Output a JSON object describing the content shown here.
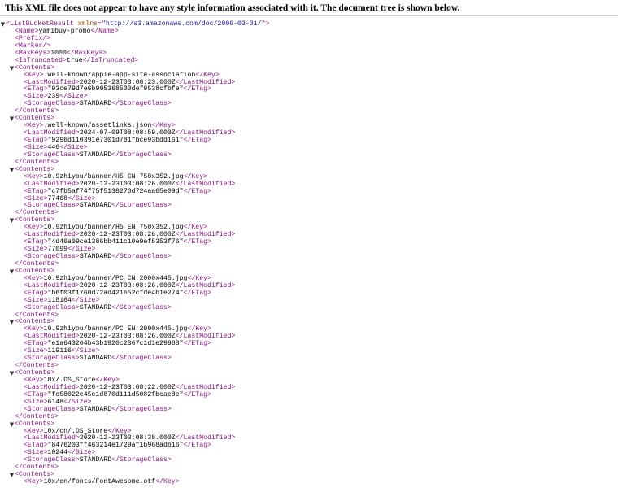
{
  "banner": "This XML file does not appear to have any style information associated with it. The document tree is shown below.",
  "root": {
    "tag": "ListBucketResult",
    "xmlns_attr": "xmlns",
    "xmlns": "http://s3.amazonaws.com/doc/2006-03-01/",
    "name": "yamibuy-promo",
    "prefix_line": "<Prefix/>",
    "marker_line": "<Marker/>",
    "max_keys": "1000",
    "is_truncated": "true"
  },
  "contents": [
    {
      "key": ".well-known/apple-app-site-association",
      "last_modified": "2020-12-23T03:08:23.000Z",
      "etag": "\"93ce79d7e6b905368500def9538cfbfe\"",
      "size": "239",
      "storage_class": "STANDARD"
    },
    {
      "key": ".well-known/assetlinks.json",
      "last_modified": "2024-07-09T08:08:59.000Z",
      "etag": "\"9296d110391e7301d781fbce93bdd161\"",
      "size": "446",
      "storage_class": "STANDARD"
    },
    {
      "key": "10.9zhiyou/banner/H5 CN 750x352.jpg",
      "last_modified": "2020-12-23T03:08:26.000Z",
      "etag": "\"c7fb5af74f75f5138270d724aa65e09d\"",
      "size": "77468",
      "storage_class": "STANDARD"
    },
    {
      "key": "10.9zhiyou/banner/H5 EN 750x352.jpg",
      "last_modified": "2020-12-23T03:08:26.000Z",
      "etag": "\"4d46a09ce1386bb411c10e9ef5353f76\"",
      "size": "77099",
      "storage_class": "STANDARD"
    },
    {
      "key": "10.9zhiyou/banner/PC CN 2000x445.jpg",
      "last_modified": "2020-12-23T03:08:26.000Z",
      "etag": "\"b6f03f1760d72ad421652cfde4b1e274\"",
      "size": "118184",
      "storage_class": "STANDARD"
    },
    {
      "key": "10.9zhiyou/banner/PC EN 2000x445.jpg",
      "last_modified": "2020-12-23T03:08:26.000Z",
      "etag": "\"e1a643204b43b1920c2367c1d1e29988\"",
      "size": "119116",
      "storage_class": "STANDARD"
    },
    {
      "key": "10x/.DS_Store",
      "last_modified": "2020-12-23T03:08:22.000Z",
      "etag": "\"fc58022e45c1d870d111d5082fbcae8e\"",
      "size": "6148",
      "storage_class": "STANDARD"
    },
    {
      "key": "10x/cn/.DS_Store",
      "last_modified": "2020-12-23T03:08:38.000Z",
      "etag": "\"8476203ff463214e1729af1b968adb16\"",
      "size": "10244",
      "storage_class": "STANDARD"
    },
    {
      "key": "10x/cn/fonts/FontAwesome.otf"
    }
  ]
}
